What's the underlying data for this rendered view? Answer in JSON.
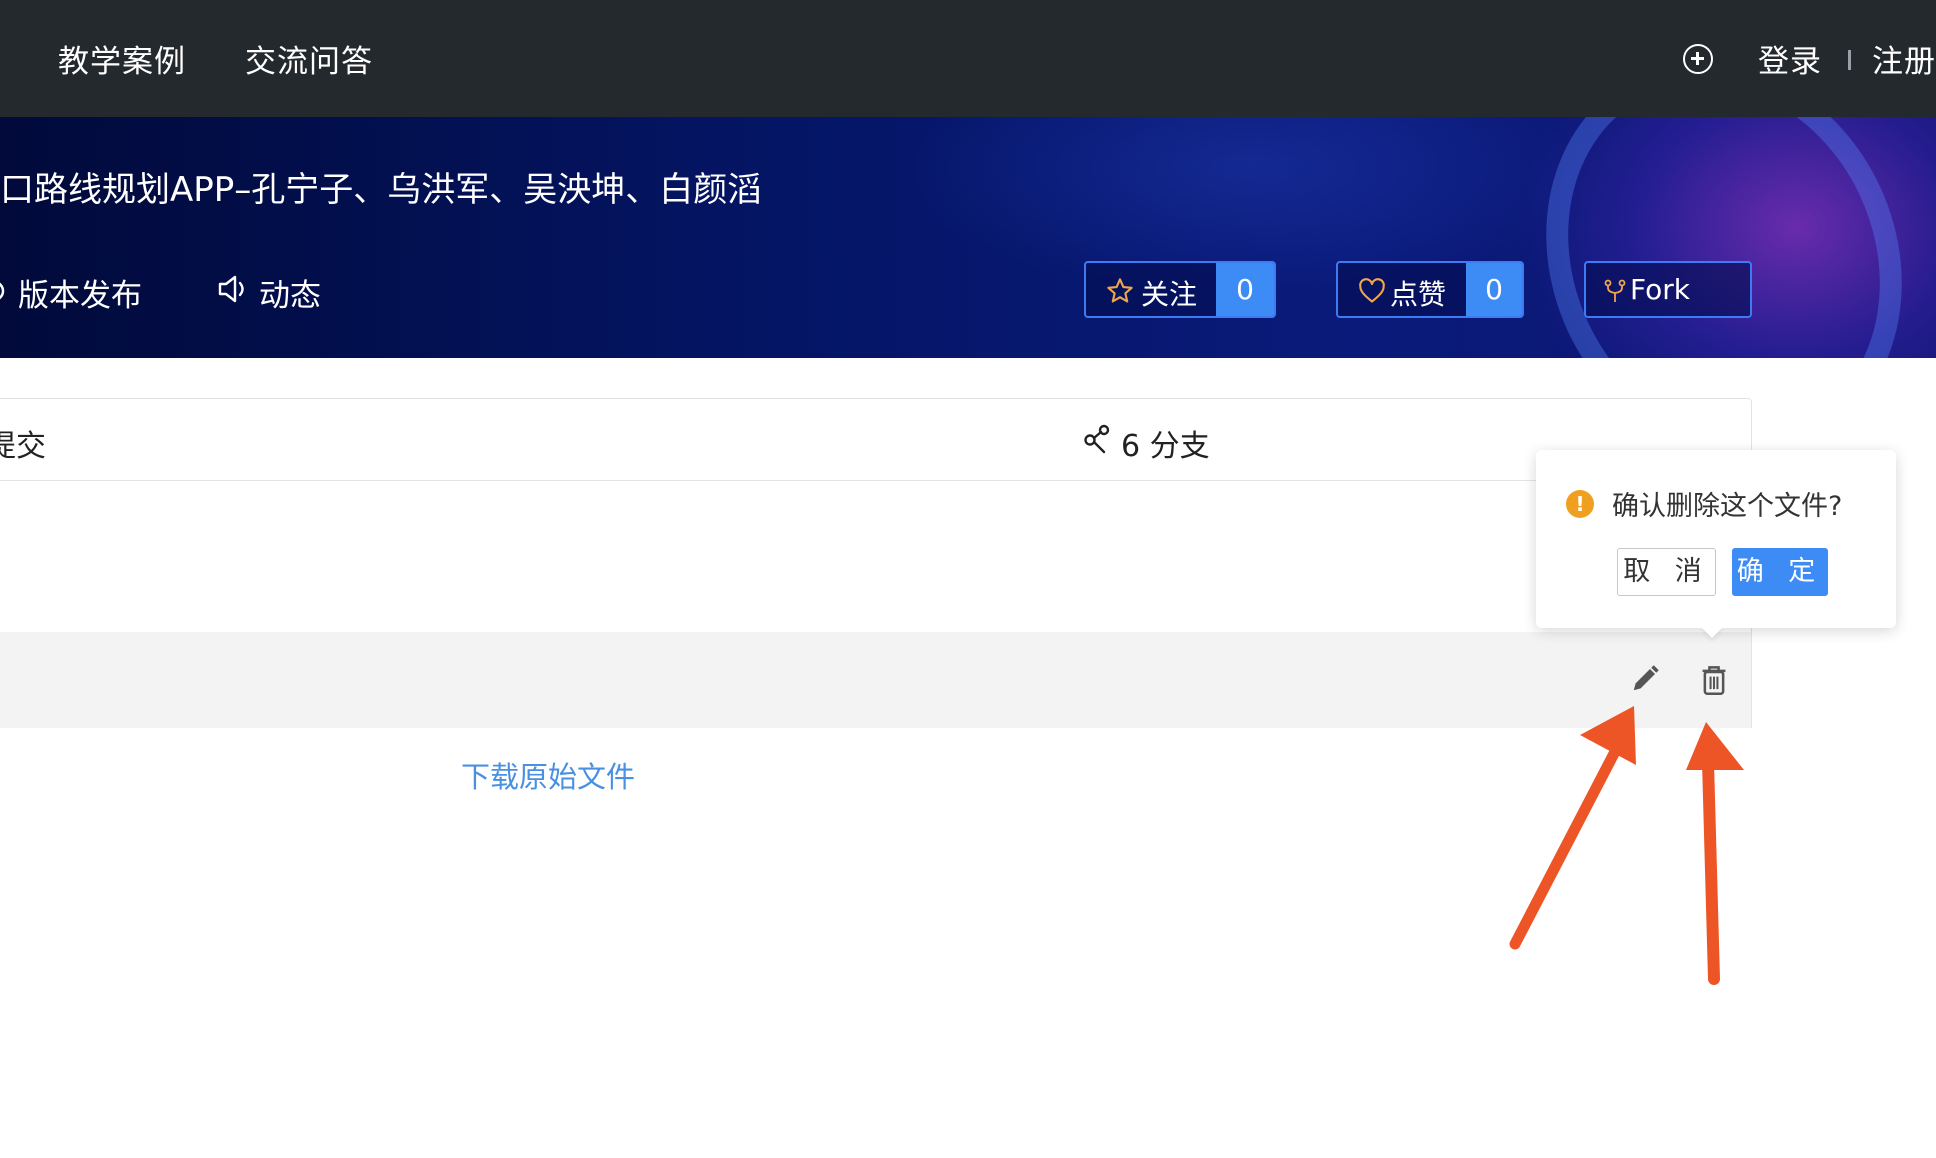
{
  "topnav": {
    "links": [
      "教学案例",
      "交流问答"
    ],
    "plus_icon": "plus-circle-icon",
    "login": "登录",
    "separator": "|",
    "register": "注册"
  },
  "banner": {
    "repo_title": "口路线规划APP–孔宁子、乌洪军、吴泱坤、白颜滔",
    "tabs": [
      {
        "label": "版本发布",
        "icon": "tag-icon"
      },
      {
        "label": "动态",
        "icon": "speaker-icon"
      }
    ],
    "watch": {
      "label": "关注",
      "count": "0",
      "icon": "star-icon"
    },
    "star": {
      "label": "点赞",
      "count": "0",
      "icon": "heart-icon"
    },
    "fork": {
      "label": "Fork",
      "icon": "fork-icon"
    }
  },
  "stats": {
    "commits_label": "提交",
    "branches_label": "6 分支",
    "branch_icon": "branch-icon"
  },
  "file": {
    "edit_icon": "pencil-icon",
    "delete_icon": "trash-icon",
    "download_link": "下载原始文件"
  },
  "popconfirm": {
    "icon": "warning-icon",
    "message": "确认删除这个文件?",
    "cancel_label": "取 消",
    "ok_label": "确 定"
  },
  "colors": {
    "nav_bg": "#24292e",
    "accent": "#3d8bf5",
    "link": "#4a90e2",
    "annotation_arrow": "#ee5526",
    "warning": "#f0a021"
  }
}
